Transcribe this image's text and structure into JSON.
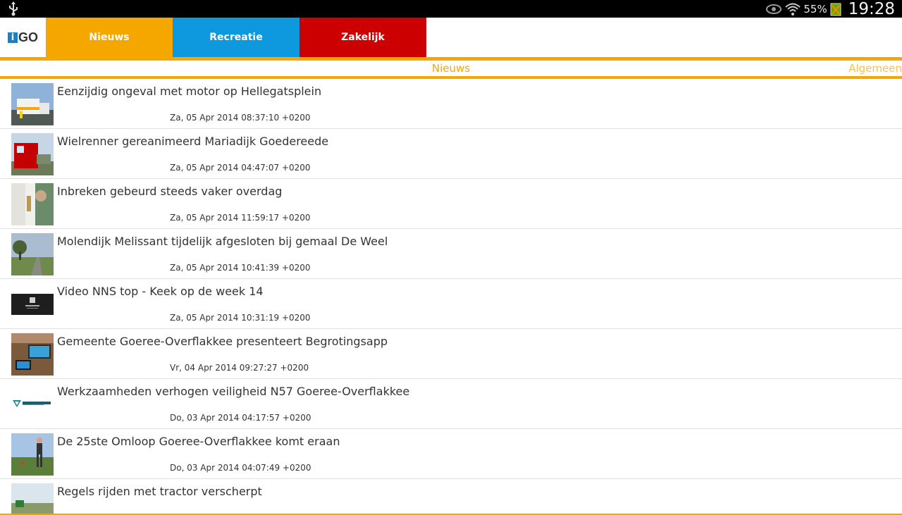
{
  "status_bar": {
    "battery_percent": "55%",
    "time": "19:28"
  },
  "app": {
    "logo_i": "i",
    "logo_text": "GO",
    "tabs": [
      {
        "label": "Nieuws",
        "color": "#f5a700"
      },
      {
        "label": "Recreatie",
        "color": "#0e98dd"
      },
      {
        "label": "Zakelijk",
        "color": "#cc0000"
      }
    ],
    "accent_color": "#f5a700"
  },
  "subheader": {
    "section": "Nieuws",
    "category": "Algemeen"
  },
  "articles": [
    {
      "title": "Eenzijdig ongeval met motor op Hellegatsplein",
      "date": "Za, 05 Apr 2014 08:37:10 +0200",
      "thumb": "ambulance-road"
    },
    {
      "title": "Wielrenner gereanimeerd Mariadijk Goedereede",
      "date": "Za, 05 Apr 2014 04:47:07 +0200",
      "thumb": "fire-truck"
    },
    {
      "title": "Inbreken gebeurd steeds vaker overdag",
      "date": "Za, 05 Apr 2014 11:59:17 +0200",
      "thumb": "door-lock"
    },
    {
      "title": "Molendijk Melissant tijdelijk afgesloten bij gemaal De Weel",
      "date": "Za, 05 Apr 2014 10:41:39 +0200",
      "thumb": "dike-road"
    },
    {
      "title": "Video NNS top - Keek op de week 14",
      "date": "Za, 05 Apr 2014 10:31:19 +0200",
      "thumb": "video-still"
    },
    {
      "title": "Gemeente Goeree-Overflakkee presenteert Begrotingsapp",
      "date": "Vr, 04 Apr 2014 09:27:27 +0200",
      "thumb": "presentation-room"
    },
    {
      "title": "Werkzaamheden verhogen veiligheid N57 Goeree-Overflakkee",
      "date": "Do, 03 Apr 2014 04:17:57 +0200",
      "thumb": "rijkswaterstaat-logo"
    },
    {
      "title": "De 25ste Omloop Goeree-Overflakkee komt eraan",
      "date": "Do, 03 Apr 2014 04:07:49 +0200",
      "thumb": "walker-field"
    },
    {
      "title": "Regels rijden met tractor verscherpt",
      "date": "",
      "thumb": "tractor-field"
    }
  ]
}
